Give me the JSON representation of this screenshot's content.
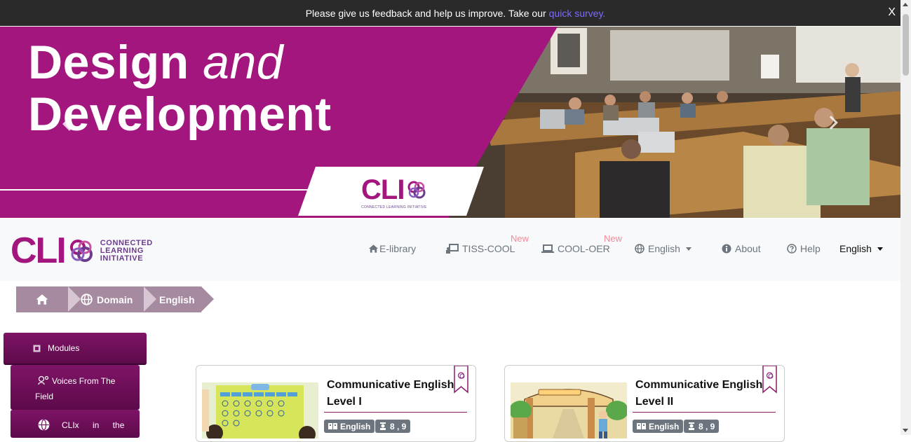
{
  "feedback": {
    "text": "Please give us feedback and help us improve. Take our",
    "link": "quick survey.",
    "close": "X"
  },
  "banner": {
    "title_line1": "Design",
    "title_and": "and",
    "title_line2": "Development",
    "logo_text": "CLI",
    "logo_tagline": "CONNECTED LEARNING INITIATIVE"
  },
  "brand": {
    "logo_text": "CLI",
    "line1": "CONNECTED",
    "line2": "LEARNING",
    "line3": "INITIATIVE"
  },
  "nav": {
    "elibrary": "E-library",
    "tiss_cool": "TISS-COOL",
    "cool_oer": "COOL-OER",
    "new_badge_1": "New",
    "new_badge_2": "New",
    "language_menu": "English",
    "about": "About",
    "help": "Help",
    "ui_language": "English"
  },
  "breadcrumb": {
    "domain": "Domain",
    "current": "English"
  },
  "sidebar": {
    "modules": "Modules",
    "voices": "Voices From The Field",
    "clix": "CLIx in the"
  },
  "cards": [
    {
      "title": "Communicative English: Level I",
      "language": "English",
      "grades": "8 , 9"
    },
    {
      "title": "Communicative English: Level II",
      "language": "English",
      "grades": "8 , 9"
    }
  ],
  "colors": {
    "brand_magenta": "#a3167e",
    "brand_purple": "#6b3c8c",
    "sidebar_button": "#7f1467",
    "breadcrumb": "#a58aa0",
    "badge_grey": "#6c757d",
    "new_badge": "#f08a9c"
  },
  "icons": [
    "home-icon",
    "desktop-chalkboard-icon",
    "laptop-icon",
    "globe-icon",
    "info-circle-icon",
    "question-circle-icon",
    "book-icon",
    "graduate-icon",
    "bookmark-ribbon-icon",
    "puzzle-icon",
    "chevron-left-icon",
    "chevron-right-icon",
    "close-icon"
  ]
}
